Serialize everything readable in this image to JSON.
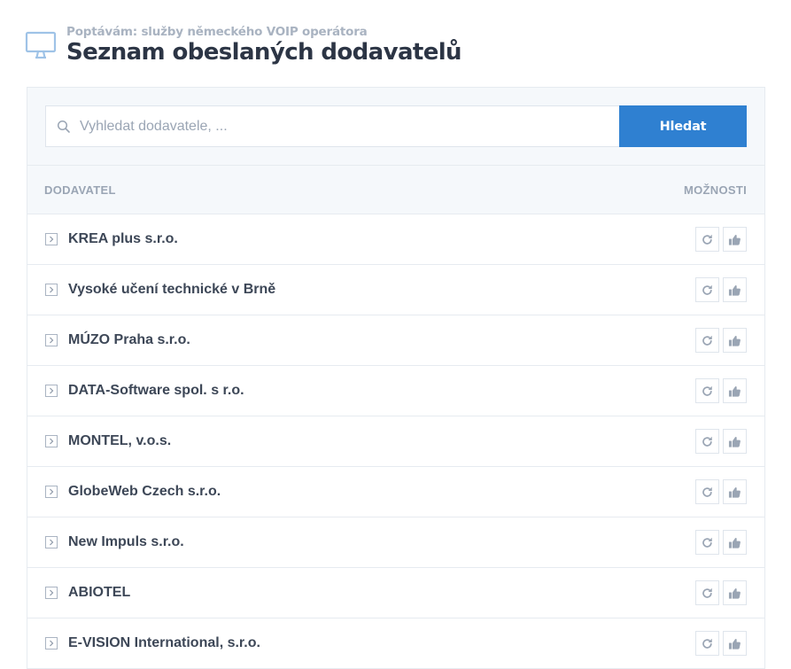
{
  "header": {
    "subtitle": "Poptávám: služby německého VOIP operátora",
    "title": "Seznam obeslaných dodavatelů"
  },
  "search": {
    "placeholder": "Vyhledat dodavatele, ...",
    "value": "",
    "button_label": "Hledat"
  },
  "table": {
    "columns": {
      "supplier": "DODAVATEL",
      "options": "MOŽNOSTI"
    },
    "rows": [
      {
        "name": "KREA plus s.r.o."
      },
      {
        "name": "Vysoké učení technické v Brně"
      },
      {
        "name": "MÚZO Praha s.r.o."
      },
      {
        "name": "DATA-Software spol. s r.o."
      },
      {
        "name": "MONTEL, v.o.s."
      },
      {
        "name": "GlobeWeb Czech s.r.o."
      },
      {
        "name": "New Impuls s.r.o."
      },
      {
        "name": "ABIOTEL"
      },
      {
        "name": "E-VISION International, s.r.o."
      }
    ]
  },
  "icons": {
    "header": "monitor-icon",
    "search": "search-icon",
    "row_expand": "chevron-right-box-icon",
    "row_resend": "refresh-icon",
    "row_approve": "thumbs-up-icon"
  },
  "colors": {
    "primary_button": "#2f80d1",
    "panel_background": "#f5f8fb",
    "title_text": "#2c3545",
    "muted_text": "#9aa5b4"
  }
}
